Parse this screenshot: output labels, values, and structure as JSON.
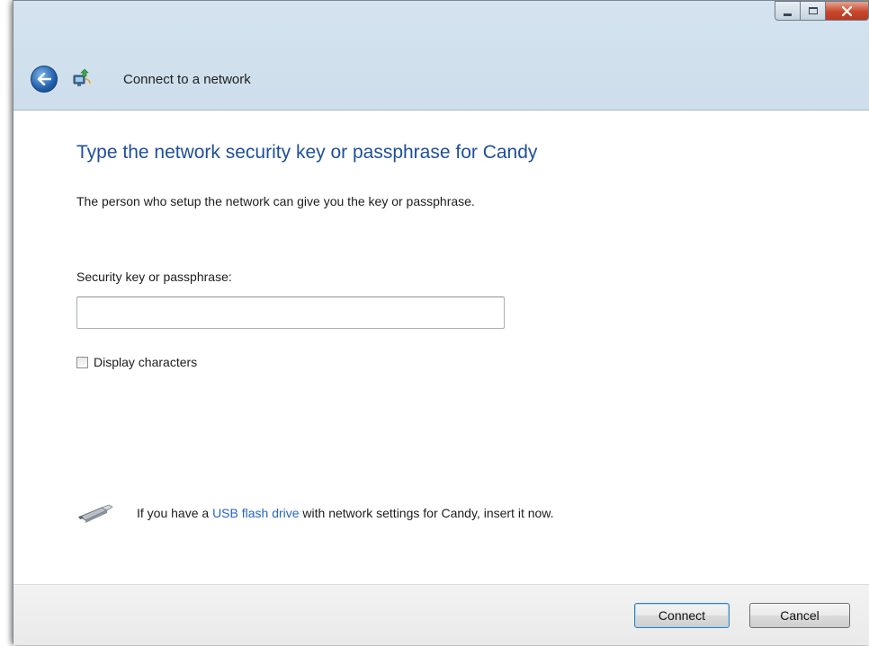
{
  "window": {
    "title": "Connect to a network",
    "caption_buttons": [
      "minimize",
      "maximize",
      "close"
    ]
  },
  "icons": {
    "back": "back-arrow-icon",
    "network": "network-icon",
    "usb": "usb-flash-drive-icon"
  },
  "main": {
    "heading": "Type the network security key or passphrase for Candy",
    "description": "The person who setup the network can give you the key or passphrase.",
    "key_label": "Security key or passphrase:",
    "key_value": "",
    "display_characters_label": "Display characters",
    "display_characters_checked": false,
    "usb_text_prefix": "If you have a ",
    "usb_link": "USB flash drive",
    "usb_text_suffix": " with network settings for Candy, insert it now."
  },
  "footer": {
    "connect_label": "Connect",
    "cancel_label": "Cancel"
  },
  "colors": {
    "heading": "#1f4f9a",
    "link": "#2465c4",
    "close_button": "#c9472c"
  }
}
